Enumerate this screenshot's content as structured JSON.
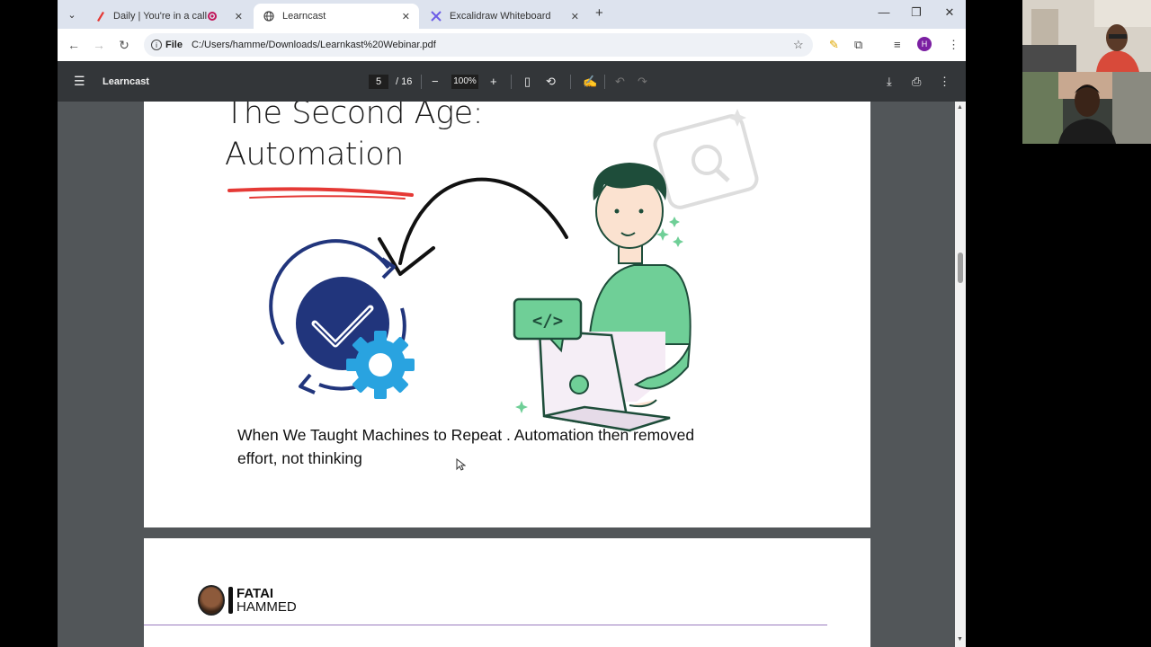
{
  "tabs": [
    {
      "title": "Daily | You're in a call",
      "favicon": "daily-pencil-icon",
      "recording": true
    },
    {
      "title": "Learncast",
      "favicon": "globe-icon",
      "active": true
    },
    {
      "title": "Excalidraw Whiteboard",
      "favicon": "excalidraw-icon"
    }
  ],
  "address": {
    "scheme": "File",
    "url": "C:/Users/hamme/Downloads/Learnkast%20Webinar.pdf"
  },
  "profile_initial": "H",
  "viewer": {
    "title": "Learncast",
    "page_current": "5",
    "page_total": "/ 16",
    "zoom": "100%"
  },
  "slide": {
    "title_line1": "The Second Age:",
    "title_line2": "Automation",
    "caption": "When We Taught Machines to Repeat . Automation then removed effort, not thinking",
    "code_tag": "</>"
  },
  "next_page": {
    "brand_first": "FATAI",
    "brand_last": "HAMMED"
  },
  "colors": {
    "accent_red": "#e53935",
    "navy": "#1f3a8a",
    "gear_blue": "#29a3e0",
    "shirt_green": "#6fcf97"
  }
}
